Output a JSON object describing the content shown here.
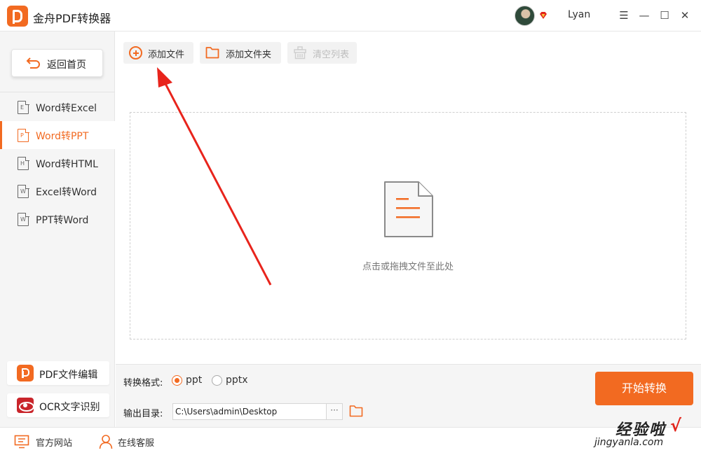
{
  "app": {
    "title": "金舟PDF转换器",
    "username": "Lyan"
  },
  "window_controls": {
    "menu": "☰",
    "minimize": "—",
    "maximize": "☐",
    "close": "✕"
  },
  "sidebar": {
    "back_label": "返回首页",
    "items": [
      {
        "label": "Word转Excel",
        "badge": "E",
        "active": false
      },
      {
        "label": "Word转PPT",
        "badge": "P",
        "active": true
      },
      {
        "label": "Word转HTML",
        "badge": "H",
        "active": false
      },
      {
        "label": "Excel转Word",
        "badge": "W",
        "active": false
      },
      {
        "label": "PPT转Word",
        "badge": "W",
        "active": false
      }
    ],
    "tools": [
      {
        "label": "PDF文件编辑",
        "icon": "pdf-edit-icon"
      },
      {
        "label": "OCR文字识别",
        "icon": "ocr-eye-icon"
      }
    ]
  },
  "toolbar": {
    "add_file": "添加文件",
    "add_folder": "添加文件夹",
    "clear_list": "清空列表"
  },
  "dropzone": {
    "hint": "点击或拖拽文件至此处"
  },
  "settings": {
    "format_label": "转换格式:",
    "formats": [
      {
        "label": "ppt",
        "selected": true
      },
      {
        "label": "pptx",
        "selected": false
      }
    ],
    "output_label": "输出目录:",
    "output_path": "C:\\Users\\admin\\Desktop",
    "browse_label": "···",
    "start_label": "开始转换"
  },
  "footer": {
    "website": "官方网站",
    "support": "在线客服"
  },
  "watermark": {
    "top": "经验啦",
    "check": "√",
    "bottom": "jingyanla.com"
  },
  "colors": {
    "accent": "#f26a21",
    "arrow": "#e8241c",
    "sidebar_bg": "#f5f5f5"
  }
}
